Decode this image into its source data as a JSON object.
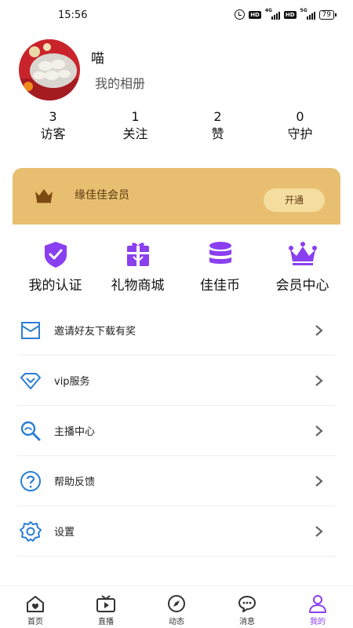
{
  "status_bar": {
    "time": "15:56",
    "network_1": "4G",
    "network_2": "5G",
    "hd": "HD",
    "battery": "79"
  },
  "profile": {
    "username": "喵",
    "album_link": "我的相册"
  },
  "stats": [
    {
      "value": "3",
      "label": "访客"
    },
    {
      "value": "1",
      "label": "关注"
    },
    {
      "value": "2",
      "label": "赞"
    },
    {
      "value": "0",
      "label": "守护"
    }
  ],
  "vip_banner": {
    "title": "缘佳佳会员",
    "button_label": "开通"
  },
  "quick_actions": [
    {
      "label": "我的认证",
      "icon": "shield-check-icon"
    },
    {
      "label": "礼物商城",
      "icon": "gift-icon"
    },
    {
      "label": "佳佳币",
      "icon": "coin-stack-icon"
    },
    {
      "label": "会员中心",
      "icon": "crown-icon"
    }
  ],
  "menu": [
    {
      "label": "邀请好友下载有奖",
      "icon": "envelope-icon"
    },
    {
      "label": "vip服务",
      "icon": "diamond-icon"
    },
    {
      "label": "主播中心",
      "icon": "search-person-icon"
    },
    {
      "label": "帮助反馈",
      "icon": "question-icon"
    },
    {
      "label": "设置",
      "icon": "gear-icon"
    }
  ],
  "tabs": [
    {
      "label": "首页",
      "icon": "home-icon"
    },
    {
      "label": "直播",
      "icon": "tv-icon"
    },
    {
      "label": "动态",
      "icon": "compass-icon"
    },
    {
      "label": "消息",
      "icon": "chat-icon"
    },
    {
      "label": "我的",
      "icon": "person-icon",
      "active": true
    }
  ],
  "colors": {
    "accent": "#8a3ff0",
    "vip_gold": "#e8bf70",
    "menu_icon_blue": "#2a7fd4"
  }
}
